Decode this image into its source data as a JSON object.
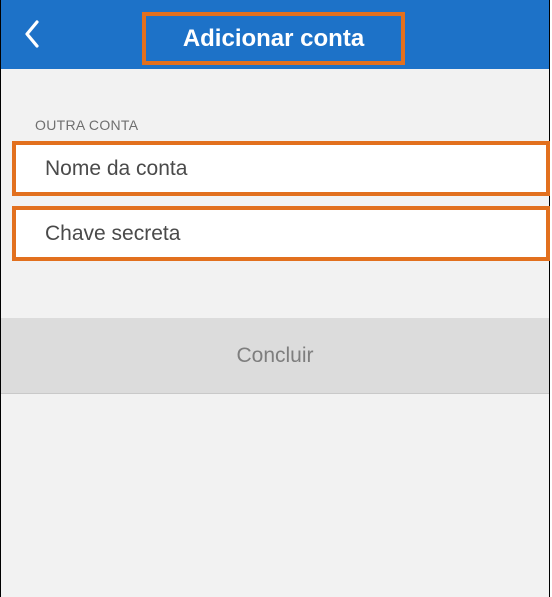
{
  "header": {
    "title": "Adicionar conta",
    "back_icon": "chevron-left-icon",
    "background_color": "#1d72c8"
  },
  "form": {
    "section_label": "OUTRA CONTA",
    "account_name_placeholder": "Nome da conta",
    "secret_key_placeholder": "Chave secreta",
    "done_label": "Concluir"
  },
  "highlight_color": "#e2701e"
}
